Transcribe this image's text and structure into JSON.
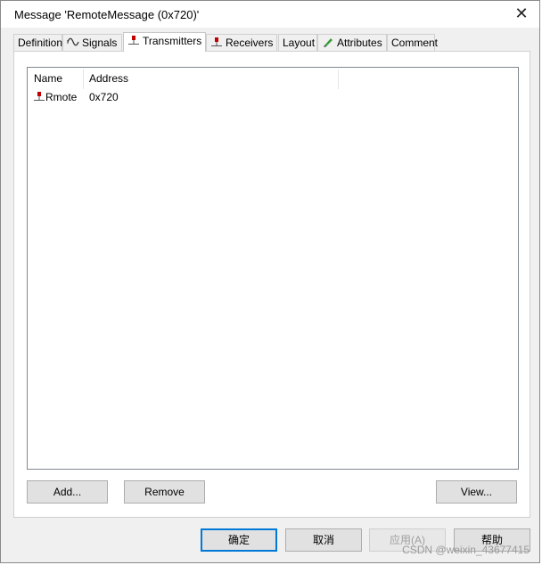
{
  "window": {
    "title": "Message 'RemoteMessage (0x720)'",
    "close_glyph": "✕"
  },
  "tabs": [
    {
      "label": "Definition",
      "icon": null
    },
    {
      "label": "Signals",
      "icon": "signal-wave-icon"
    },
    {
      "label": "Transmitters",
      "icon": "transmitter-node-icon",
      "active": true
    },
    {
      "label": "Receivers",
      "icon": "receiver-node-icon"
    },
    {
      "label": "Layout",
      "icon": null
    },
    {
      "label": "Attributes",
      "icon": "attribute-pencil-icon"
    },
    {
      "label": "Comment",
      "icon": null
    }
  ],
  "list": {
    "columns": [
      "Name",
      "Address"
    ],
    "rows": [
      {
        "name": "Rmote",
        "address": "0x720",
        "icon": "node-icon"
      }
    ]
  },
  "panel_buttons": {
    "add": "Add...",
    "remove": "Remove",
    "view": "View..."
  },
  "dialog_buttons": {
    "ok": "确定",
    "cancel": "取消",
    "apply": "应用(A)",
    "help": "帮助"
  },
  "watermark": "CSDN @weixin_43677415",
  "colors": {
    "accent": "#0078d7",
    "node_red": "#c00000"
  }
}
